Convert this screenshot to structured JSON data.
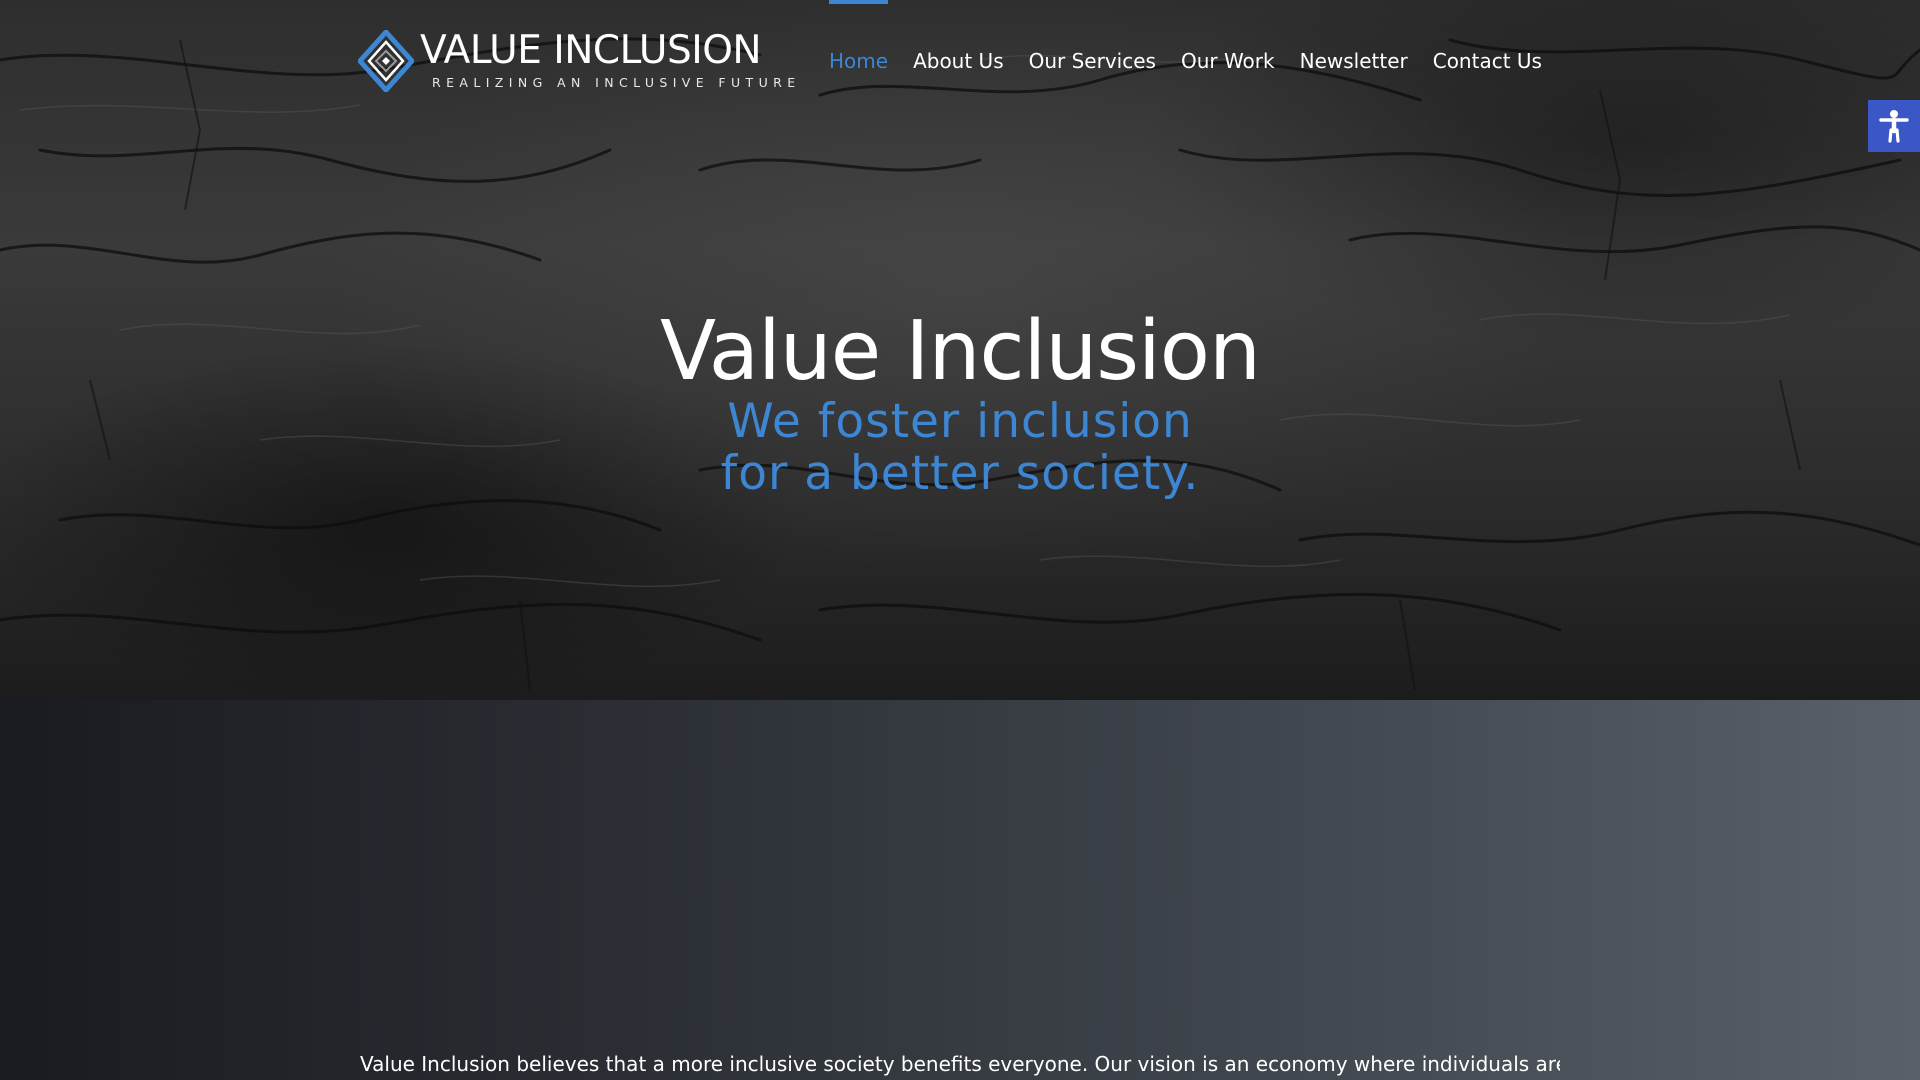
{
  "header": {
    "logo": {
      "name": "VALUE INCLUSION",
      "tagline": "REALIZING AN INCLUSIVE FUTURE",
      "icon": "diamond-logo-icon"
    },
    "nav": [
      {
        "label": "Home",
        "active": true
      },
      {
        "label": "About Us",
        "active": false
      },
      {
        "label": "Our Services",
        "active": false
      },
      {
        "label": "Our Work",
        "active": false
      },
      {
        "label": "Newsletter",
        "active": false
      },
      {
        "label": "Contact Us",
        "active": false
      }
    ]
  },
  "accessibility_button": {
    "icon": "accessibility-icon"
  },
  "hero": {
    "title": "Value Inclusion",
    "subtitle_line1": "We foster inclusion",
    "subtitle_line2": "for a better society."
  },
  "intro": {
    "text": "Value Inclusion believes that a more inclusive society benefits everyone. Our vision is an economy where individuals are"
  },
  "colors": {
    "accent": "#3d86d3",
    "accessibility_bg": "#3a57c5",
    "text": "#ffffff"
  }
}
